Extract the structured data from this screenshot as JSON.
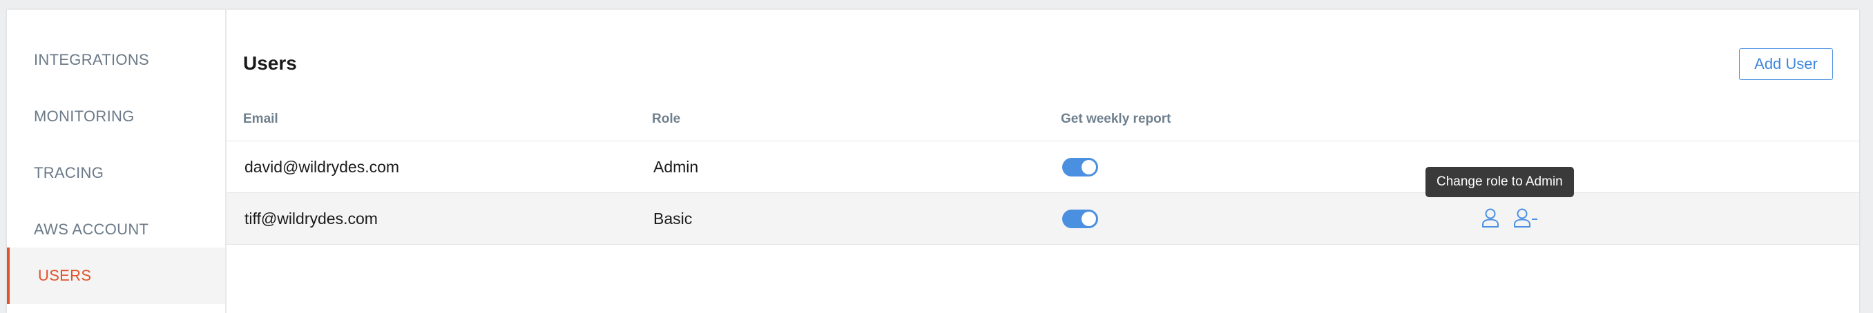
{
  "sidebar": {
    "items": [
      {
        "label": "INTEGRATIONS",
        "active": false
      },
      {
        "label": "MONITORING",
        "active": false
      },
      {
        "label": "TRACING",
        "active": false
      },
      {
        "label": "AWS ACCOUNT",
        "active": false
      },
      {
        "label": "USERS",
        "active": true
      }
    ]
  },
  "main": {
    "title": "Users",
    "add_user_label": "Add User",
    "columns": [
      "Email",
      "Role",
      "Get weekly report"
    ],
    "rows": [
      {
        "email": "david@wildrydes.com",
        "role": "Admin",
        "weekly_report": true
      },
      {
        "email": "tiff@wildrydes.com",
        "role": "Basic",
        "weekly_report": true
      }
    ],
    "row_actions": {
      "change_role_icon": "user-icon",
      "remove_user_icon": "user-minus-icon"
    },
    "tooltip": "Change role to Admin"
  },
  "colors": {
    "accent": "#4a90e2",
    "active_nav": "#e0522b",
    "muted_text": "#6b7a88",
    "tooltip_bg": "#3a3a3a"
  }
}
